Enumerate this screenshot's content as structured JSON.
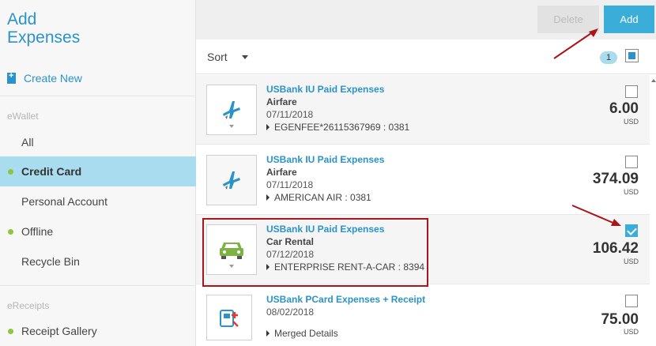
{
  "sidebar": {
    "title": "Add\nExpenses",
    "create_new": "Create New",
    "sections": [
      {
        "heading": "eWallet"
      },
      {
        "heading": "eReceipts"
      }
    ],
    "ewallet_items": [
      {
        "label": "All"
      },
      {
        "label": "Credit Card"
      },
      {
        "label": "Personal Account"
      },
      {
        "label": "Offline"
      },
      {
        "label": "Recycle Bin"
      }
    ],
    "ereceipt_items": [
      {
        "label": "Receipt Gallery"
      }
    ],
    "active_item": "Credit Card",
    "active_color": "#a8dcee",
    "dot_color": "#8cc63f"
  },
  "toolbar": {
    "delete_label": "Delete",
    "add_label": "Add"
  },
  "sort": {
    "label": "Sort",
    "selected_count": "1"
  },
  "expenses": [
    {
      "title": "USBank IU Paid Expenses",
      "type": "Airfare",
      "date": "07/11/2018",
      "detail": "EGENFEE*26115367969 : 0381",
      "amount": "6.00",
      "currency": "USD",
      "checked": false,
      "icon": "airplane-icon"
    },
    {
      "title": "USBank IU Paid Expenses",
      "type": "Airfare",
      "date": "07/11/2018",
      "detail": "AMERICAN AIR : 0381",
      "amount": "374.09",
      "currency": "USD",
      "checked": false,
      "icon": "airplane-icon"
    },
    {
      "title": "USBank IU Paid Expenses",
      "type": "Car Rental",
      "date": "07/12/2018",
      "detail": "ENTERPRISE RENT-A-CAR : 8394",
      "amount": "106.42",
      "currency": "USD",
      "checked": true,
      "icon": "car-icon"
    },
    {
      "title": "USBank PCard Expenses + Receipt",
      "date": "08/02/2018",
      "detail": "Merged Details",
      "amount": "75.00",
      "currency": "USD",
      "checked": false,
      "icon": "merged-receipt-icon"
    }
  ],
  "colors": {
    "accent": "#2a93c9",
    "add_button": "#3aaed8",
    "annotation": "#a8161b"
  }
}
